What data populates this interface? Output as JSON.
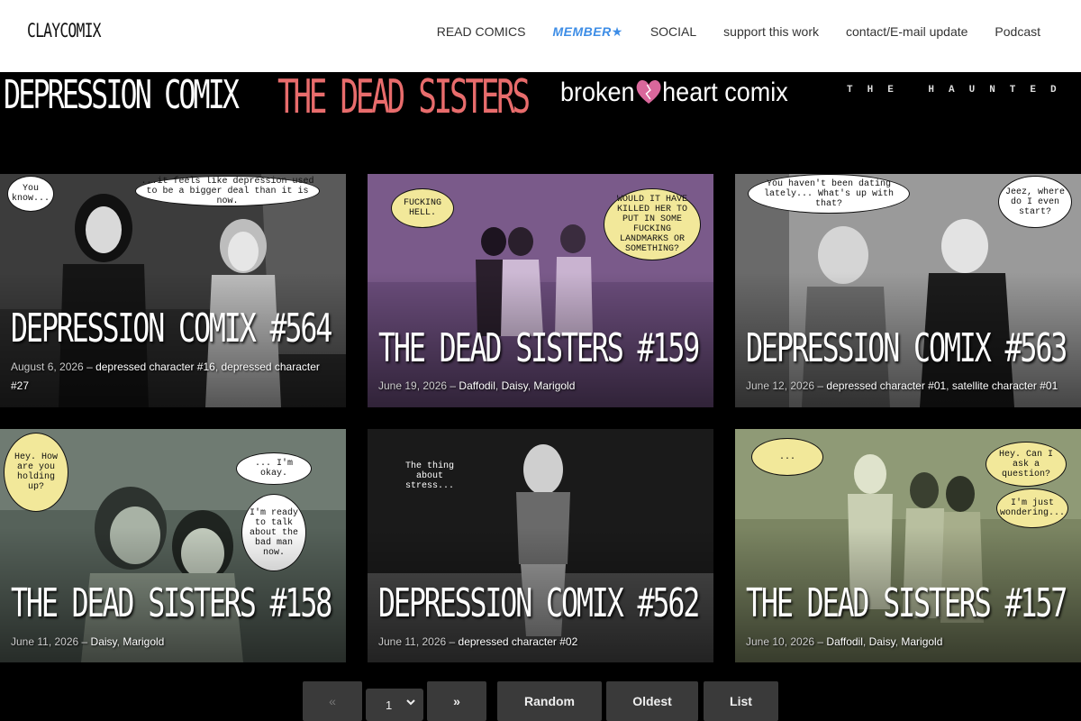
{
  "site": {
    "logo": "CLAYCOMIX"
  },
  "nav": {
    "items": [
      {
        "label": "READ COMICS"
      },
      {
        "label": "MEMBER",
        "star": "★"
      },
      {
        "label": "SOCIAL"
      },
      {
        "label": "support this work"
      },
      {
        "label": "contact/E-mail update"
      },
      {
        "label": "Podcast"
      }
    ]
  },
  "series": {
    "depression": "DEPRESSION COMIX",
    "dead_sisters": "THE DEAD SISTERS",
    "broken_left": "broken",
    "broken_heart_icon": "heart-icon",
    "broken_right": "heart comix",
    "haunted": "THE HAUNTED ME"
  },
  "cards": [
    {
      "title": "DEPRESSION COMIX #564",
      "date": "August 6, 2026",
      "tags": [
        "depressed character #16",
        "depressed character #27"
      ],
      "bubbles": [
        "You know...",
        "...it feels like depression used to be a bigger deal than it is now."
      ],
      "palette": {
        "bg": "#3c3c3c",
        "accent": "#6e6e6e"
      }
    },
    {
      "title": "THE DEAD SISTERS #159",
      "date": "June 19, 2026",
      "tags": [
        "Daffodil",
        "Daisy",
        "Marigold"
      ],
      "bubbles": [
        "FUCKING HELL.",
        "WOULD IT HAVE KILLED HER TO PUT IN SOME FUCKING LANDMARKS OR SOMETHING?"
      ],
      "palette": {
        "bg": "#6b4d7c",
        "accent": "#8b6a9a"
      }
    },
    {
      "title": "DEPRESSION COMIX #563",
      "date": "June 12, 2026",
      "tags": [
        "depressed character #01",
        "satellite character #01"
      ],
      "bubbles": [
        "You haven't been dating lately... What's up with that?",
        "Jeez, where do I even start?"
      ],
      "palette": {
        "bg": "#9a9a9a",
        "accent": "#c8c8c8"
      }
    },
    {
      "title": "THE DEAD SISTERS #158",
      "date": "June 11, 2026",
      "tags": [
        "Daisy",
        "Marigold"
      ],
      "bubbles": [
        "Hey. How are you holding up?",
        "... I'm okay.",
        "I'm ready to talk about the bad man now."
      ],
      "palette": {
        "bg": "#56625a",
        "accent": "#8a9688"
      }
    },
    {
      "title": "DEPRESSION COMIX #562",
      "date": "June 11, 2026",
      "tags": [
        "depressed character #02"
      ],
      "bubbles": [
        "The thing about stress..."
      ],
      "palette": {
        "bg": "#1a1a1a",
        "accent": "#5e5e5e"
      }
    },
    {
      "title": "THE DEAD SISTERS #157",
      "date": "June 10, 2026",
      "tags": [
        "Daffodil",
        "Daisy",
        "Marigold"
      ],
      "bubbles": [
        "...",
        "Hey. Can I ask a question?",
        "I'm just wondering..."
      ],
      "palette": {
        "bg": "#7b8562",
        "accent": "#a9b38e"
      }
    }
  ],
  "pager": {
    "prev": "«",
    "page": "1",
    "next": "»",
    "random": "Random",
    "oldest": "Oldest",
    "list": "List"
  }
}
